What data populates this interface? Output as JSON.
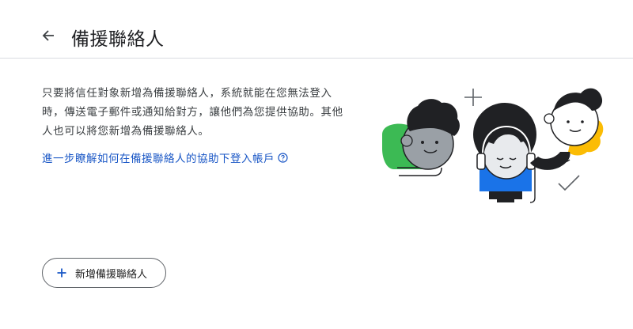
{
  "header": {
    "back_icon": "arrow-back-icon",
    "title": "備援聯絡人"
  },
  "main": {
    "description": "只要將信任對象新增為備援聯絡人，系統就能在您無法登入時，傳送電子郵件或通知給對方，讓他們為您提供協助。其他人也可以將您新增為備援聯絡人。",
    "learn_more_link": "進一步瞭解如何在備援聯絡人的協助下登入帳戶",
    "help_icon": "help-circle-icon",
    "add_button": {
      "icon": "plus-icon",
      "label": "新增備援聯絡人"
    }
  },
  "colors": {
    "accent": "#1a57c6",
    "green": "#3cba54",
    "blue": "#1a73e8",
    "yellow": "#fbbc04"
  }
}
